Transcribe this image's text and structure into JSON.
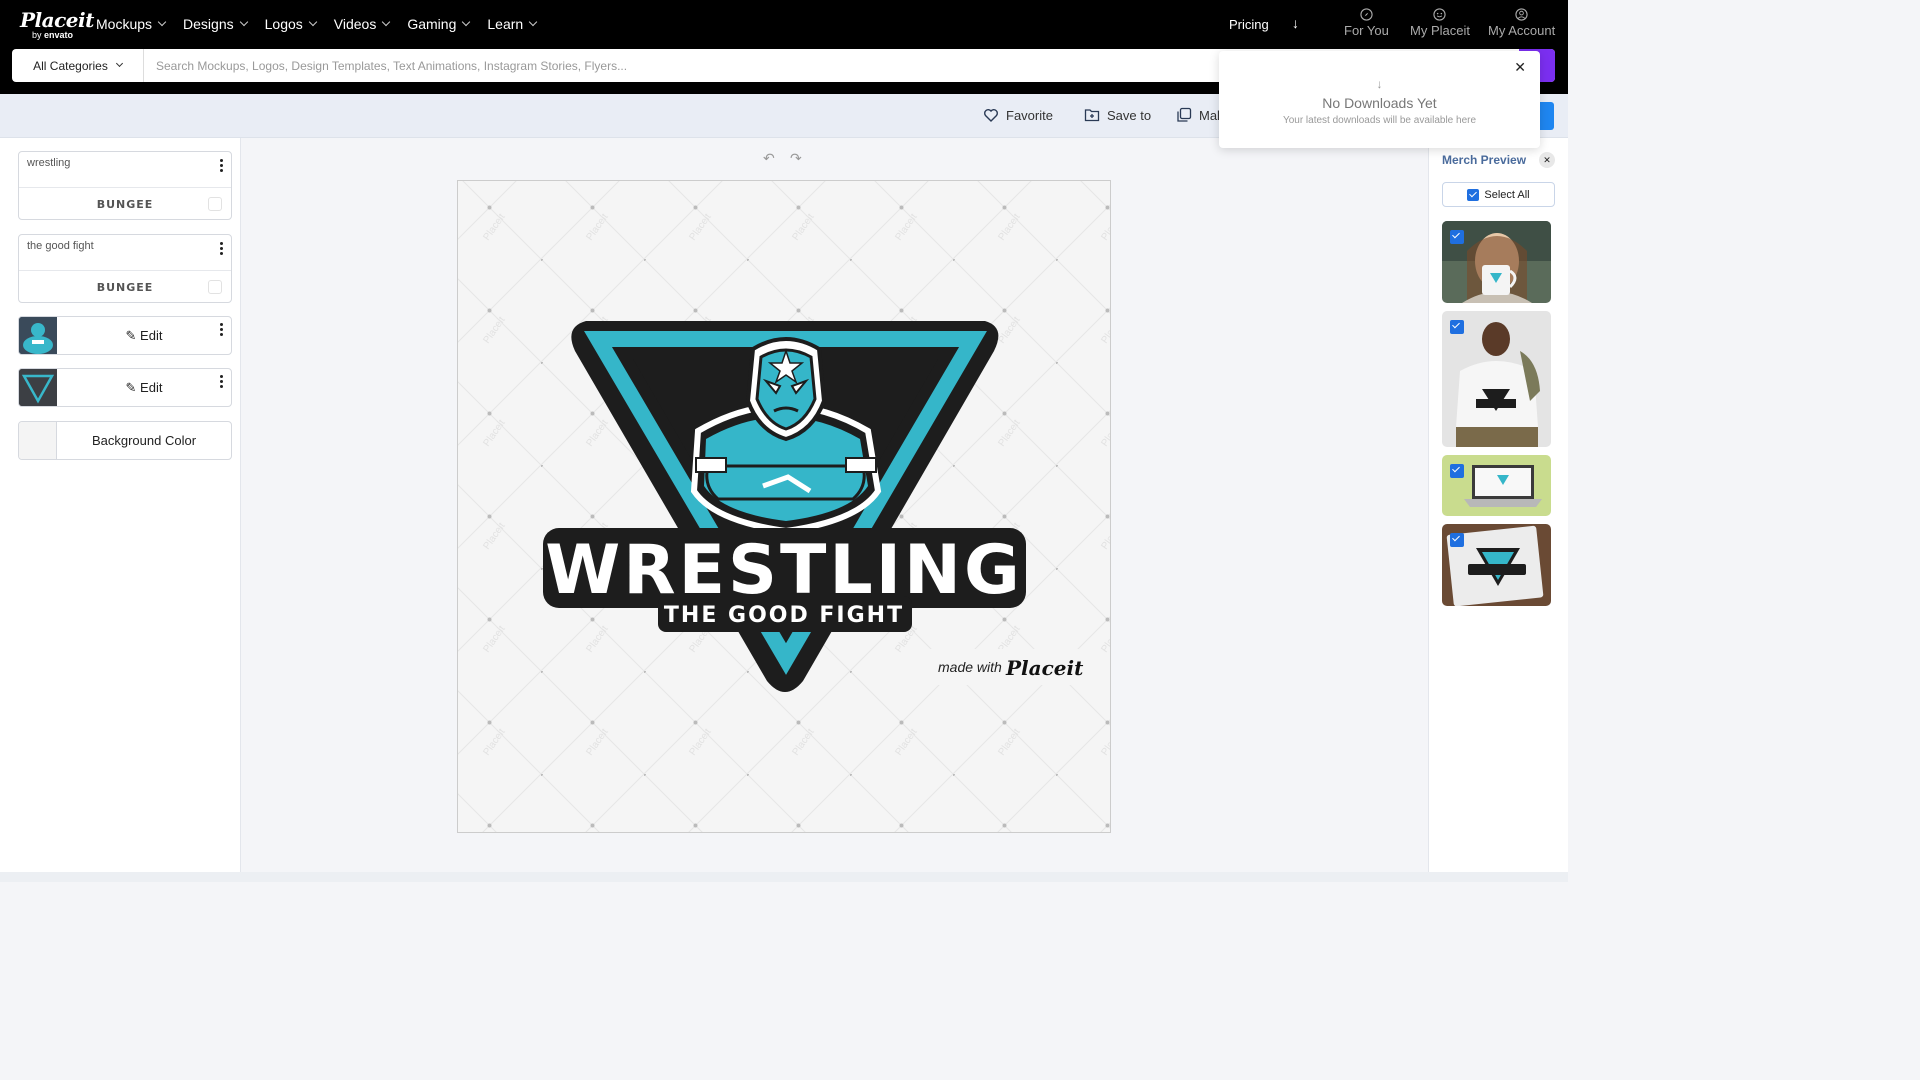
{
  "brand": {
    "name": "Placeit",
    "sub_prefix": "by",
    "sub_name": "envato"
  },
  "nav": {
    "menu": [
      "Mockups",
      "Designs",
      "Logos",
      "Videos",
      "Gaming",
      "Learn"
    ],
    "pricing": "Pricing",
    "for_you": "For You",
    "my_placeit": "My Placeit",
    "my_account": "My Account"
  },
  "search": {
    "category": "All Categories",
    "placeholder": "Search Mockups, Logos, Design Templates, Text Animations, Instagram Stories, Flyers..."
  },
  "toolbar": {
    "favorite": "Favorite",
    "save_to": "Save to",
    "make": "Mak"
  },
  "sidebar": {
    "text_layers": [
      {
        "text": "wrestling",
        "font": "BUNGEE"
      },
      {
        "text": "the good fight",
        "font": "BUNGEE"
      }
    ],
    "edit_label": "Edit",
    "background_label": "Background Color"
  },
  "canvas": {
    "title": "WRESTLING",
    "subtitle": "THE GOOD FIGHT",
    "watermark_prefix": "made with",
    "watermark_brand": "Placeit",
    "tile_text": "Placeit"
  },
  "merch": {
    "title": "Merch Preview",
    "close": "✕",
    "select_all": "Select All"
  },
  "downloads": {
    "close": "✕",
    "arrow": "↓",
    "title": "No Downloads Yet",
    "subtitle": "Your latest downloads will be available here"
  },
  "colors": {
    "accent_teal": "#35b6c9",
    "dark": "#1d1d1d",
    "purple": "#7b2ff0",
    "blue": "#1f86f0"
  }
}
